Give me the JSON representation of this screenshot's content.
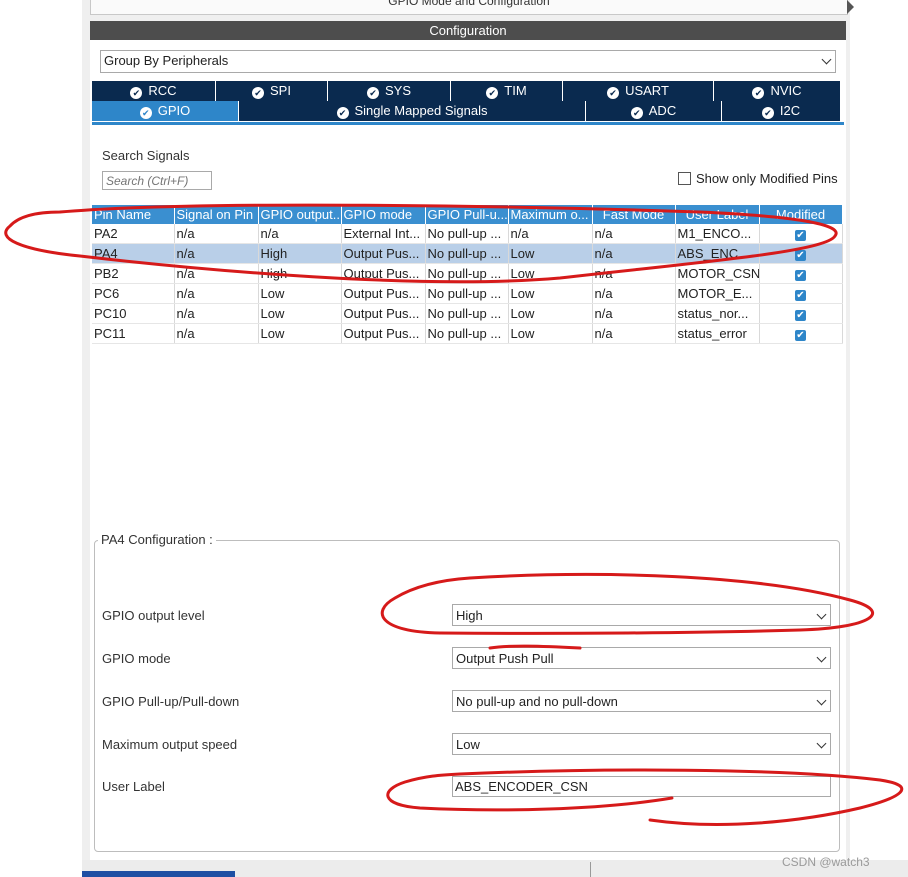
{
  "top_panel": {
    "title": "GPIO Mode and Configuration"
  },
  "config_header": "Configuration",
  "group_by": {
    "value": "Group By Peripherals"
  },
  "tabs_row1": [
    "RCC",
    "SPI",
    "SYS",
    "TIM",
    "USART",
    "NVIC"
  ],
  "tabs_row2": [
    "GPIO",
    "Single Mapped Signals",
    "ADC",
    "I2C"
  ],
  "active_tab": "GPIO",
  "search": {
    "label": "Search Signals",
    "placeholder": "Search (Ctrl+F)"
  },
  "show_modified": "Show only Modified Pins",
  "table": {
    "headers": [
      "Pin Name",
      "Signal on Pin",
      "GPIO output...",
      "GPIO mode",
      "GPIO Pull-u...",
      "Maximum o...",
      "Fast Mode",
      "User Label",
      "Modified"
    ],
    "rows": [
      [
        "PA2",
        "n/a",
        "n/a",
        "External Int...",
        "No pull-up ...",
        "n/a",
        "n/a",
        "M1_ENCO..."
      ],
      [
        "PA4",
        "n/a",
        "High",
        "Output Pus...",
        "No pull-up ...",
        "Low",
        "n/a",
        "ABS_ENC..."
      ],
      [
        "PB2",
        "n/a",
        "High",
        "Output Pus...",
        "No pull-up ...",
        "Low",
        "n/a",
        "MOTOR_CSN"
      ],
      [
        "PC6",
        "n/a",
        "Low",
        "Output Pus...",
        "No pull-up ...",
        "Low",
        "n/a",
        "MOTOR_E..."
      ],
      [
        "PC10",
        "n/a",
        "Low",
        "Output Pus...",
        "No pull-up ...",
        "Low",
        "n/a",
        "status_nor..."
      ],
      [
        "PC11",
        "n/a",
        "Low",
        "Output Pus...",
        "No pull-up ...",
        "Low",
        "n/a",
        "status_error"
      ]
    ],
    "selected_row": "PA4"
  },
  "pin_config": {
    "title": "PA4 Configuration :",
    "output_level_label": "GPIO output level",
    "output_level_value": "High",
    "mode_label": "GPIO mode",
    "mode_value": "Output Push Pull",
    "pull_label": "GPIO Pull-up/Pull-down",
    "pull_value": "No pull-up and no pull-down",
    "speed_label": "Maximum output speed",
    "speed_value": "Low",
    "user_label_label": "User Label",
    "user_label_value": "ABS_ENCODER_CSN"
  },
  "watermark": "CSDN @watch3",
  "colors": {
    "tab_dark": "#0a2a4f",
    "tab_active": "#2e86c9",
    "table_header": "#3a8fd0",
    "selected_row": "#b9cfe8",
    "annotation": "#d61a1a"
  }
}
